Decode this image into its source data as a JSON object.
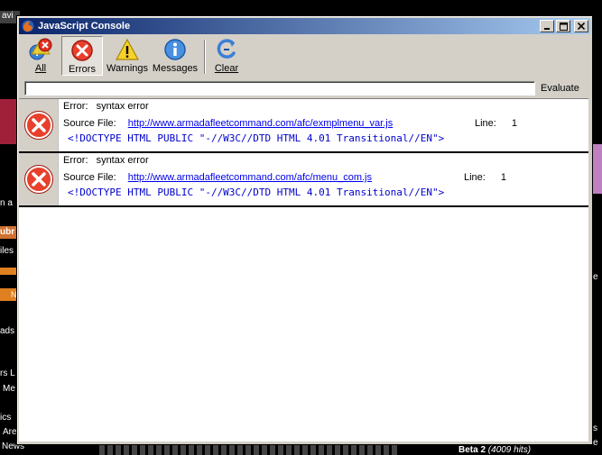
{
  "window": {
    "title": "JavaScript Console"
  },
  "toolbar": {
    "all": "All",
    "errors": "Errors",
    "warnings": "Warnings",
    "messages": "Messages",
    "clear": "Clear"
  },
  "evaluate": {
    "input_value": "",
    "button_label": "Evaluate"
  },
  "entries": [
    {
      "type_label": "Error:",
      "message": "syntax error",
      "source_label": "Source File:",
      "source_url": "http://www.armadafleetcommand.com/afc/exmplmenu_var.js",
      "line_label": "Line:",
      "line_number": "1",
      "code": "<!DOCTYPE HTML PUBLIC \"-//W3C//DTD HTML 4.01 Transitional//EN\">"
    },
    {
      "type_label": "Error:",
      "message": "syntax error",
      "source_label": "Source File:",
      "source_url": "http://www.armadafleetcommand.com/afc/menu_com.js",
      "line_label": "Line:",
      "line_number": "1",
      "code": "<!DOCTYPE HTML PUBLIC \"-//W3C//DTD HTML 4.01 Transitional//EN\">"
    }
  ],
  "background": {
    "tab_fragment": "avi",
    "fragments": [
      "n a",
      "ubr",
      "iles",
      "N",
      "ads",
      "rs L",
      "Me",
      "ics",
      "Are",
      "News"
    ],
    "bottom_text_1": "Beta 2",
    "bottom_text_2": "(4009 hits)",
    "right_fragments": [
      "e",
      "s",
      "e"
    ]
  }
}
